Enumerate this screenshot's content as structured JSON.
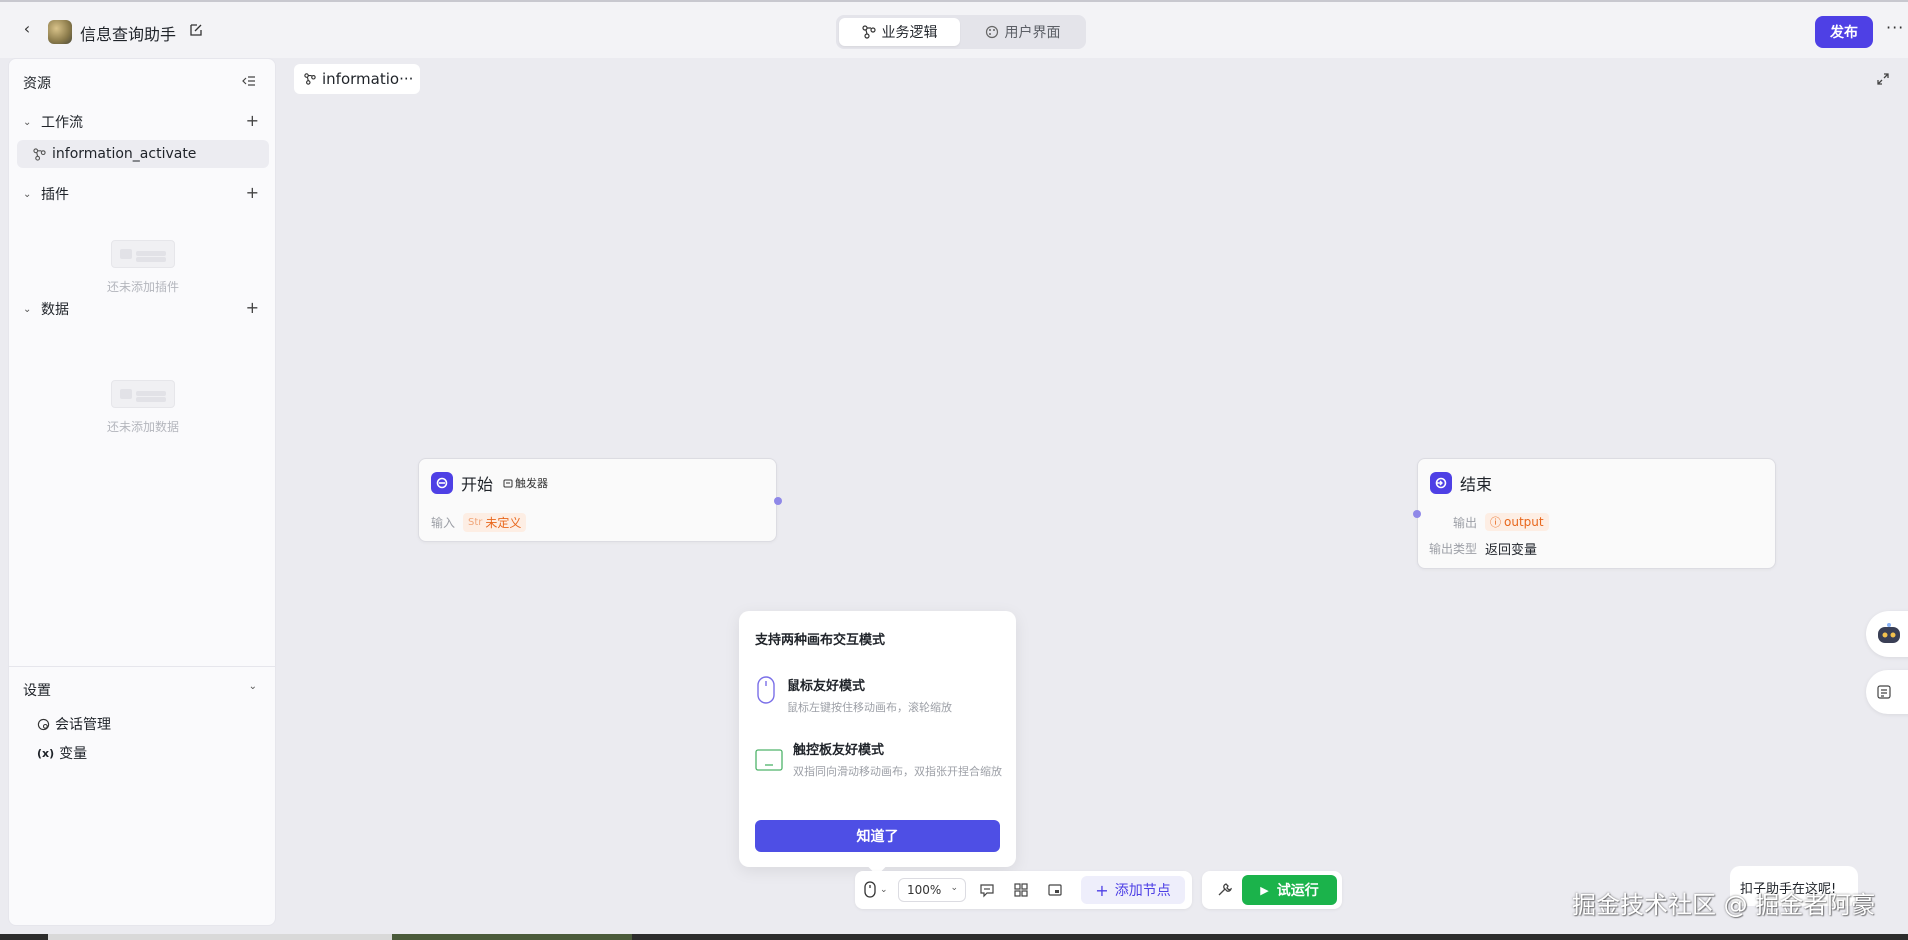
{
  "header": {
    "app_title": "信息查询助手",
    "tabs": [
      {
        "label": "业务逻辑",
        "icon": "workflow-icon",
        "active": true
      },
      {
        "label": "用户界面",
        "icon": "palette-icon",
        "active": false
      }
    ],
    "publish_label": "发布",
    "more_label": "···"
  },
  "sidebar": {
    "title": "资源",
    "sections": {
      "workflow": {
        "label": "工作流",
        "items": [
          {
            "label": "information_activate"
          }
        ]
      },
      "plugin": {
        "label": "插件",
        "empty_text": "还未添加插件"
      },
      "data": {
        "label": "数据",
        "empty_text": "还未添加数据"
      }
    },
    "settings": {
      "label": "设置",
      "items": [
        {
          "label": "会话管理",
          "icon": "chat-settings-icon"
        },
        {
          "label": "变量",
          "icon": "variable-icon",
          "icon_text": "(x)"
        }
      ]
    }
  },
  "canvas": {
    "tab_label": "informatio···",
    "start_node": {
      "title": "开始",
      "trigger_label": "触发器",
      "input_key": "输入",
      "input_type": "Str",
      "input_value": "未定义"
    },
    "end_node": {
      "title": "结束",
      "output_key": "输出",
      "output_value": "output",
      "output_type_key": "输出类型",
      "output_type_value": "返回变量"
    }
  },
  "popover": {
    "title": "支持两种画布交互模式",
    "mouse_title": "鼠标友好模式",
    "mouse_desc": "鼠标左键按住移动画布，滚轮缩放",
    "trackpad_title": "触控板友好模式",
    "trackpad_desc": "双指同向滑动移动画布，双指张开捏合缩放",
    "button_label": "知道了"
  },
  "toolbar": {
    "zoom": "100%",
    "add_node_label": "添加节点",
    "run_label": "试运行"
  },
  "helper": {
    "bubble_text": "扣子助手在这呢!"
  },
  "watermark": "掘金技术社区 @ 掘金者阿豪",
  "colors": {
    "accent": "#4e40e5",
    "run_green": "#1bb34b",
    "warning_orange": "#e8671c",
    "canvas_bg": "#ebebf0"
  }
}
